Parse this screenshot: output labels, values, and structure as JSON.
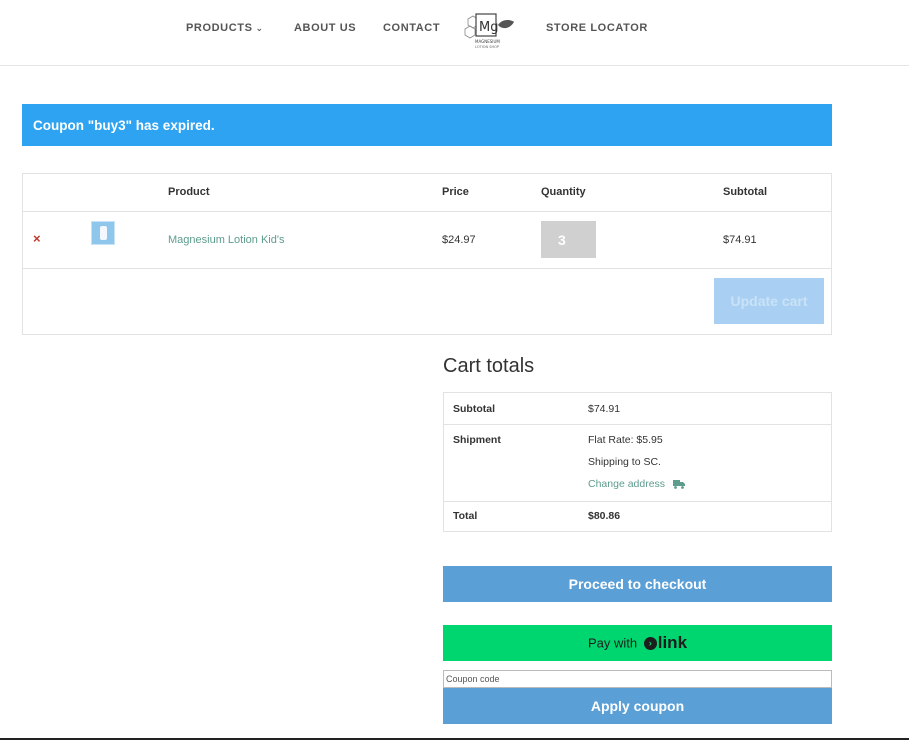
{
  "nav": {
    "products": "PRODUCTS",
    "about": "ABOUT US",
    "contact": "CONTACT",
    "store_locator": "STORE LOCATOR"
  },
  "logo": {
    "symbol": "Mg",
    "text_line1": "MAGNESIUM",
    "text_line2": "LOTION SHOP"
  },
  "notice": {
    "message": "Coupon \"buy3\" has expired.",
    "color": "#2ea3f2"
  },
  "cart": {
    "headers": {
      "product": "Product",
      "price": "Price",
      "quantity": "Quantity",
      "subtotal": "Subtotal"
    },
    "items": [
      {
        "remove": "×",
        "name": "Magnesium Lotion Kid's",
        "price": "$24.97",
        "quantity": "3",
        "subtotal": "$74.91"
      }
    ],
    "update_label": "Update cart"
  },
  "totals": {
    "title": "Cart totals",
    "subtotal_label": "Subtotal",
    "subtotal_value": "$74.91",
    "shipment_label": "Shipment",
    "shipping_rate": "Flat Rate: $5.95",
    "shipping_to": "Shipping to SC.",
    "change_address": "Change address",
    "total_label": "Total",
    "total_value": "$80.86"
  },
  "actions": {
    "checkout_label": "Proceed to checkout",
    "pay_with": "Pay with",
    "link_word": "link",
    "coupon_placeholder": "Coupon code",
    "apply_label": "Apply coupon"
  },
  "colors": {
    "accent_blue": "#5a9fd6",
    "notice_blue": "#2ea3f2",
    "link_green": "#00d66f",
    "product_link": "#5e9c8e",
    "remove_red": "#c0392b"
  }
}
